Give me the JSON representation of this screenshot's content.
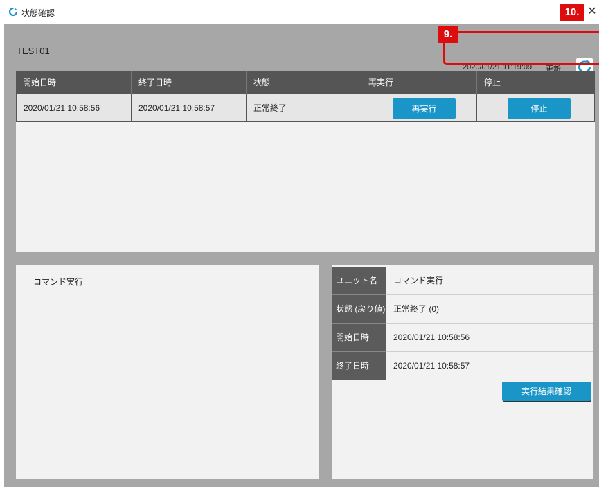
{
  "window": {
    "title": "状態確認",
    "close_glyph": "✕",
    "icon": "refresh-circle-icon"
  },
  "header": {
    "job_name": "TEST01",
    "updated_time": "2020/01/21 11:19:09",
    "updated_label": "更新",
    "refresh_icon": "refresh-icon"
  },
  "callouts": {
    "refresh_callout": "9.",
    "close_callout": "10."
  },
  "executions": {
    "columns": [
      "開始日時",
      "終了日時",
      "状態",
      "再実行",
      "停止"
    ],
    "rows": [
      {
        "start": "2020/01/21 10:58:56",
        "end": "2020/01/21 10:58:57",
        "status": "正常終了",
        "rerun_label": "再実行",
        "stop_label": "停止"
      }
    ]
  },
  "unit_panel": {
    "title": "コマンド実行"
  },
  "detail": {
    "fields": [
      {
        "label": "ユニット名",
        "value": "コマンド実行"
      },
      {
        "label": "状態 (戻り値)",
        "value": "正常終了 (0)"
      },
      {
        "label": "開始日時",
        "value": "2020/01/21 10:58:56"
      },
      {
        "label": "終了日時",
        "value": "2020/01/21 10:58:57"
      }
    ],
    "result_button_label": "実行結果確認"
  },
  "colors": {
    "accent": "#1a95c8",
    "callout": "#dd0d0d",
    "header_bg": "#555555",
    "background": "#a7a7a7"
  }
}
